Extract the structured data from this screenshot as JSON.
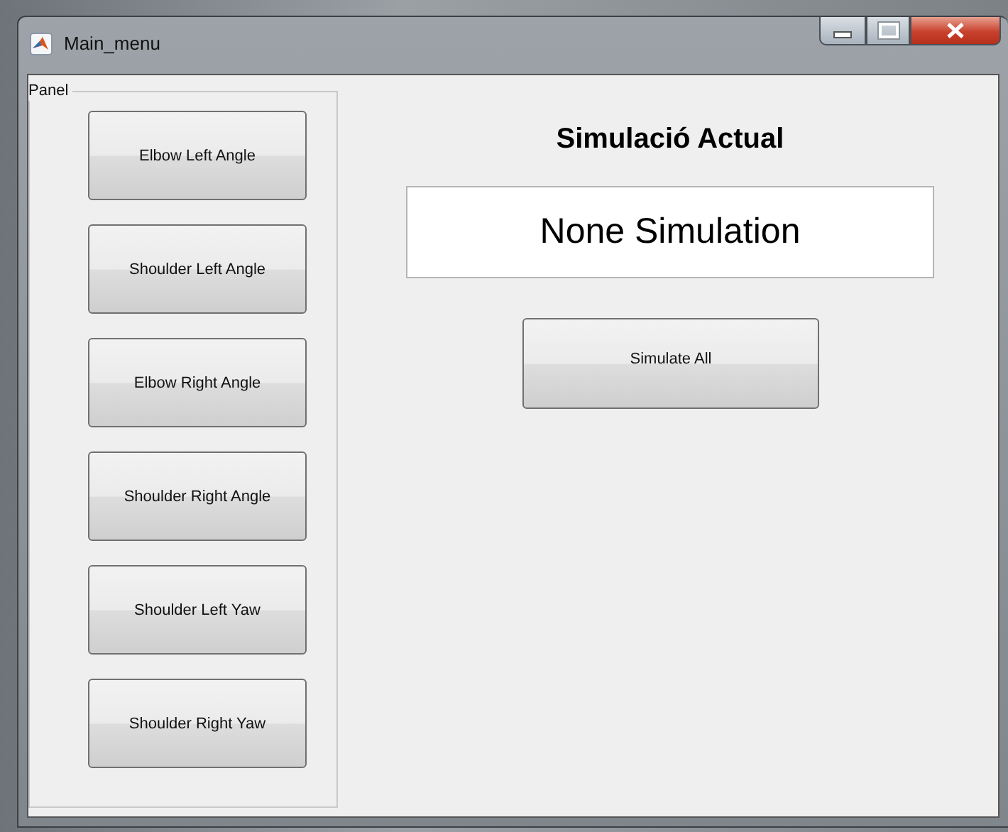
{
  "window": {
    "title": "Main_menu"
  },
  "panel": {
    "title": "Panel",
    "buttons": [
      {
        "label": "Elbow Left Angle"
      },
      {
        "label": "Shoulder Left Angle"
      },
      {
        "label": "Elbow Right Angle"
      },
      {
        "label": "Shoulder Right Angle"
      },
      {
        "label": "Shoulder Left Yaw"
      },
      {
        "label": "Shoulder Right Yaw"
      }
    ]
  },
  "heading": "Simulació Actual",
  "display": {
    "value": "None Simulation"
  },
  "simulate_button": {
    "label": "Simulate All"
  }
}
